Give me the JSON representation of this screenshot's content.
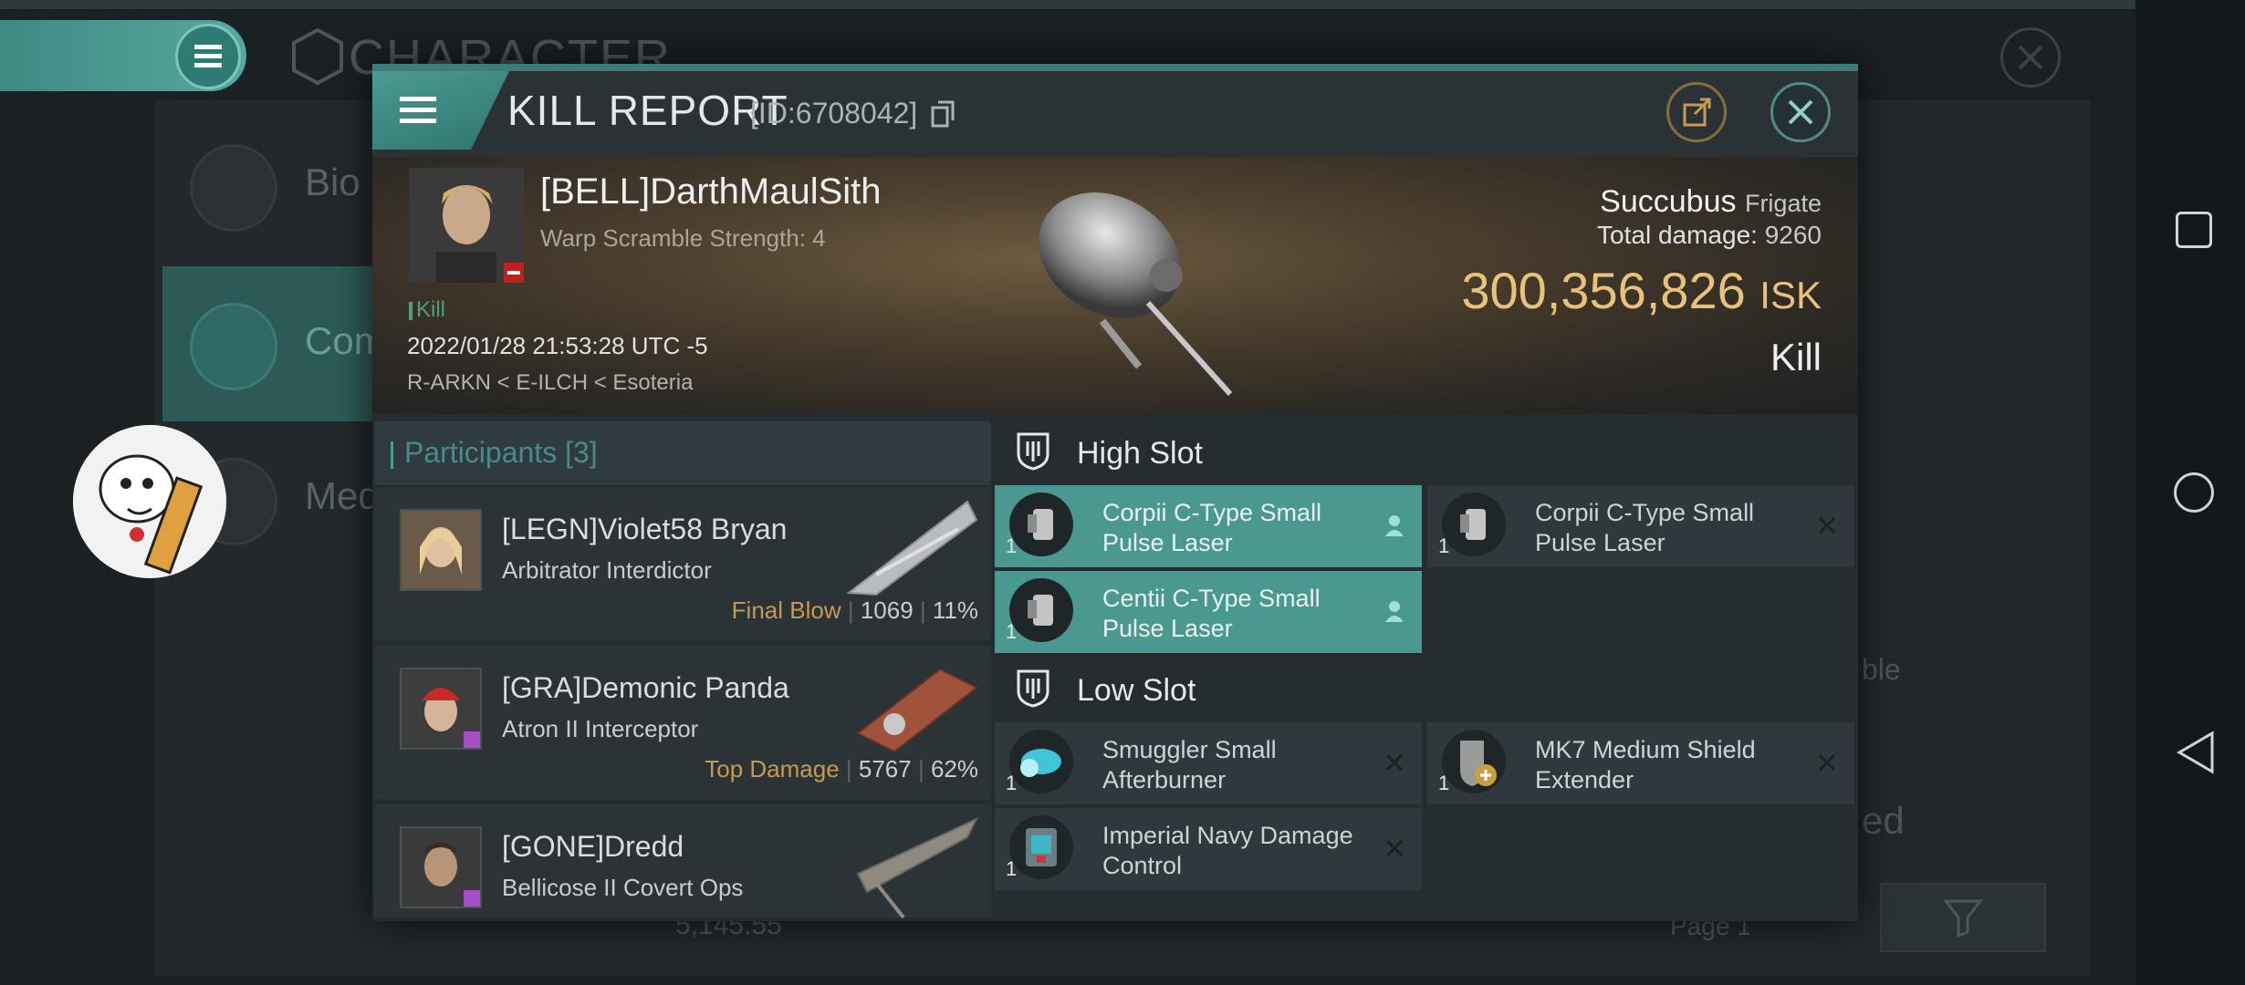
{
  "background": {
    "title": "CHARACTER",
    "side_items": [
      {
        "label": "Bio",
        "icon": "menu-lines-icon"
      },
      {
        "label": "Com",
        "icon": "crossed-swords-icon"
      },
      {
        "label": "Med",
        "icon": "star-medal-icon"
      }
    ],
    "right_text_1": "ble",
    "right_text_2": "ed",
    "bottom_value": "5,145.55",
    "page_label": "Page 1"
  },
  "dialog": {
    "title": "KILL REPORT",
    "id": "[ID:6708042]",
    "victim": {
      "name": "[BELL]DarthMaulSith",
      "warp_scramble": "Warp Scramble Strength: 4",
      "kill_tag": "Kill",
      "datetime": "2022/01/28 21:53:28 UTC -5",
      "location": "R-ARKN < E-ILCH < Esoteria"
    },
    "ship": {
      "name": "Succubus",
      "class": "Frigate",
      "total_damage_label": "Total damage:",
      "total_damage": "9260",
      "value": "300,356,826",
      "currency": "ISK",
      "result": "Kill"
    },
    "participants": {
      "label": "Participants",
      "count": "[3]",
      "rows": [
        {
          "name": "[LEGN]Violet58 Bryan",
          "ship": "Arbitrator Interdictor",
          "tag": "Final Blow",
          "damage": "1069",
          "pct": "11%"
        },
        {
          "name": "[GRA]Demonic Panda",
          "ship": "Atron II Interceptor",
          "tag": "Top Damage",
          "damage": "5767",
          "pct": "62%"
        },
        {
          "name": "[GONE]Dredd",
          "ship": "Bellicose II Covert Ops",
          "tag": "",
          "damage": "",
          "pct": ""
        }
      ]
    },
    "high_slot": {
      "label": "High Slot",
      "items": [
        {
          "qty": "1",
          "name": "Corpii C-Type Small Pulse Laser",
          "status": "pilot-icon",
          "highlight": true
        },
        {
          "qty": "1",
          "name": "Corpii C-Type Small Pulse Laser",
          "status": "close-x-icon",
          "highlight": false
        },
        {
          "qty": "1",
          "name": "Centii C-Type Small Pulse Laser",
          "status": "pilot-icon",
          "highlight": true
        }
      ]
    },
    "low_slot": {
      "label": "Low Slot",
      "items": [
        {
          "qty": "1",
          "name": "Smuggler Small Afterburner",
          "status": "close-x-icon"
        },
        {
          "qty": "1",
          "name": "MK7 Medium Shield Extender",
          "status": "close-x-icon"
        },
        {
          "qty": "1",
          "name": "Imperial Navy Damage Control",
          "status": "close-x-icon"
        }
      ]
    }
  },
  "colors": {
    "accent": "#4b9890",
    "isk": "#e8c27a",
    "tag": "#c79a54"
  }
}
